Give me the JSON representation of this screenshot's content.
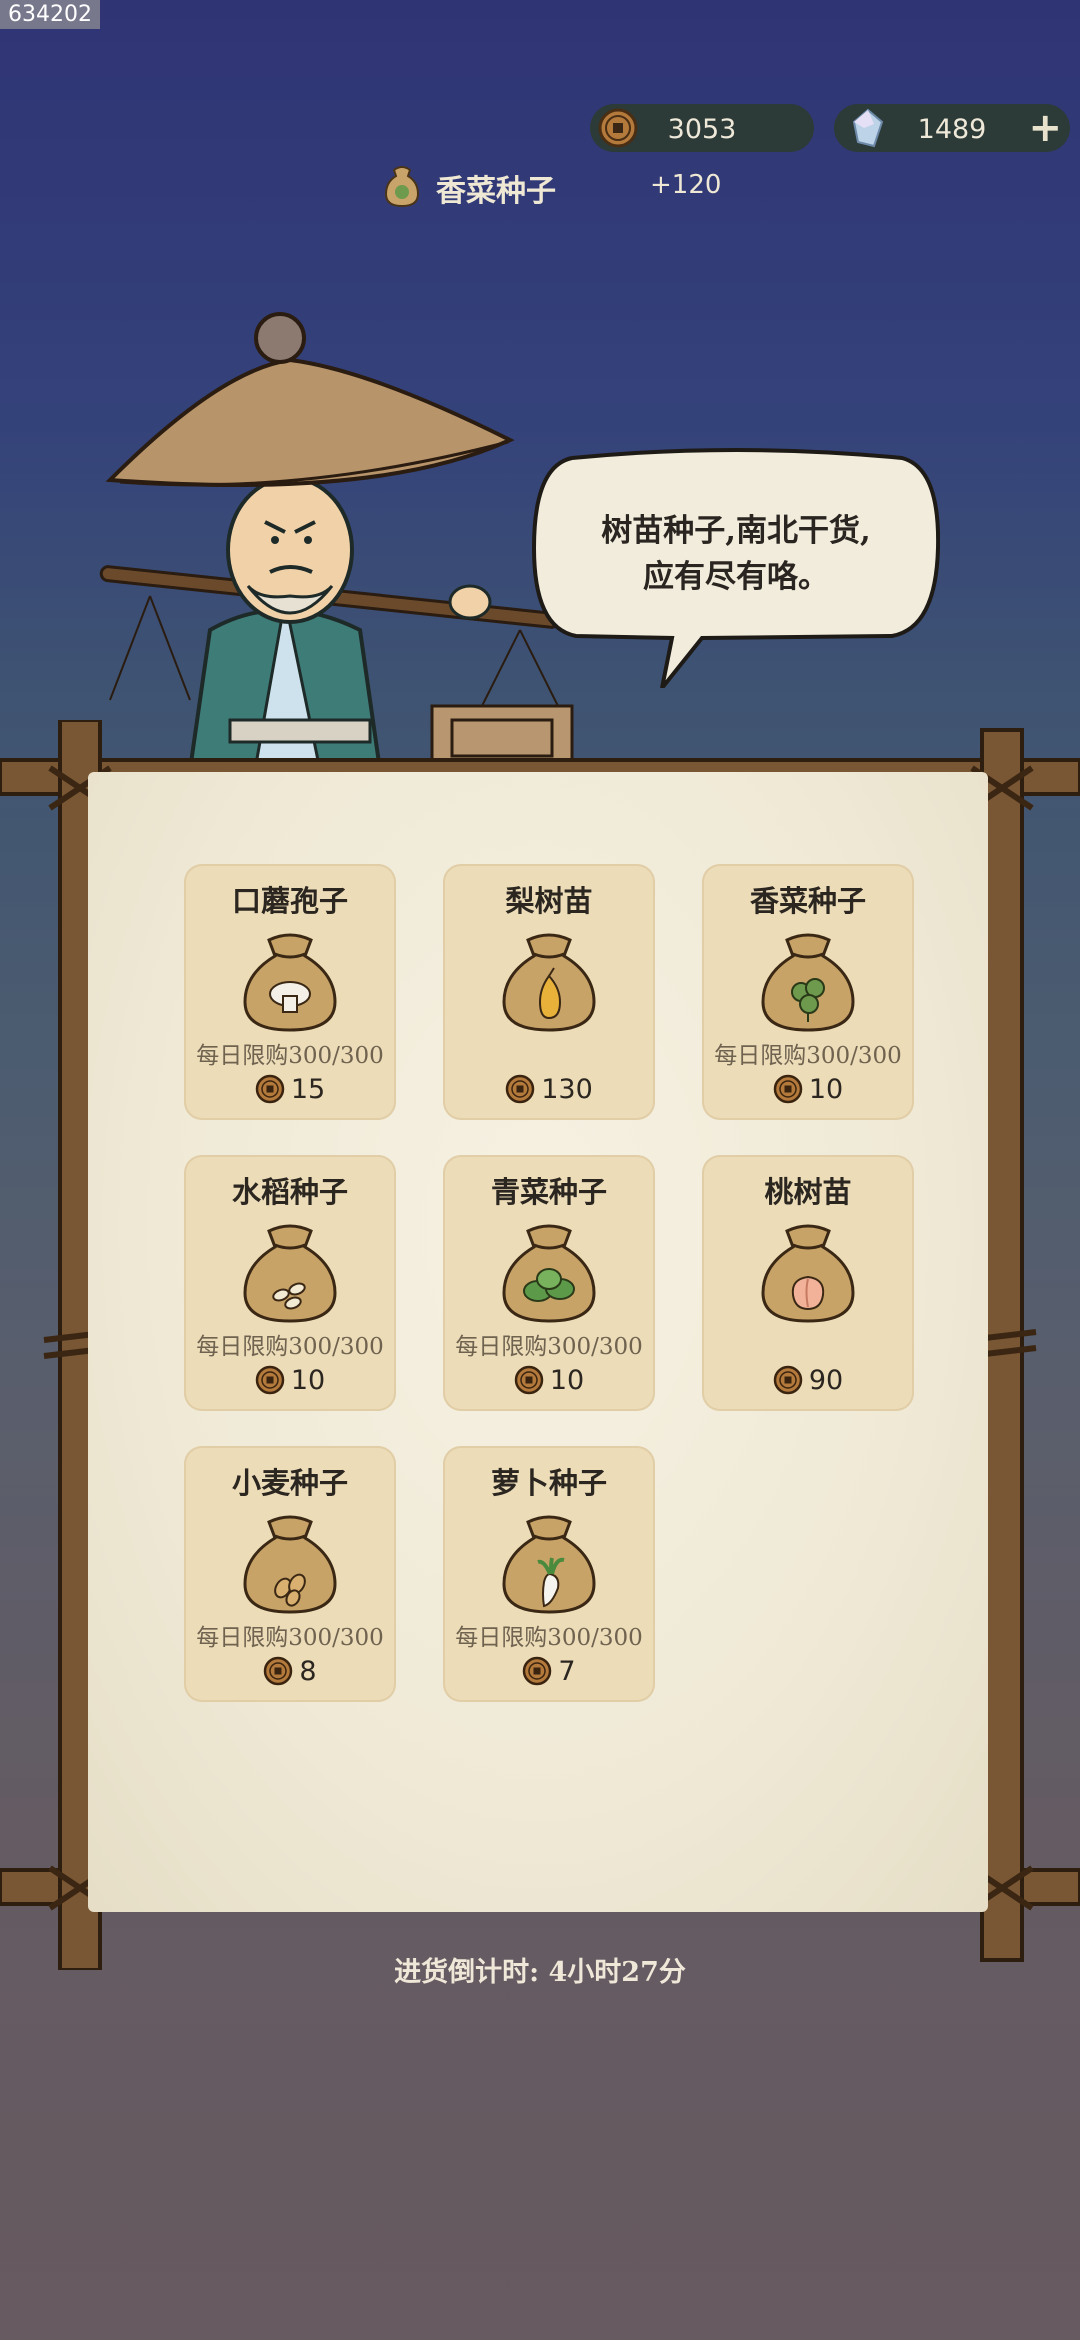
{
  "watermark": "634202",
  "currency": {
    "coins": "3053",
    "gems": "1489",
    "plus_label": "+"
  },
  "reward": {
    "name": "香菜种子",
    "amount": "+120"
  },
  "merchant": {
    "speech_line1": "树苗种子,南北干货,",
    "speech_line2": "应有尽有咯。"
  },
  "shop": {
    "items": [
      {
        "name": "口蘑孢子",
        "limit": "每日限购300/300",
        "price": "15",
        "icon": "mushroom"
      },
      {
        "name": "梨树苗",
        "limit": "",
        "price": "130",
        "icon": "pear"
      },
      {
        "name": "香菜种子",
        "limit": "每日限购300/300",
        "price": "10",
        "icon": "coriander"
      },
      {
        "name": "水稻种子",
        "limit": "每日限购300/300",
        "price": "10",
        "icon": "rice"
      },
      {
        "name": "青菜种子",
        "limit": "每日限购300/300",
        "price": "10",
        "icon": "greens"
      },
      {
        "name": "桃树苗",
        "limit": "",
        "price": "90",
        "icon": "peach"
      },
      {
        "name": "小麦种子",
        "limit": "每日限购300/300",
        "price": "8",
        "icon": "wheat"
      },
      {
        "name": "萝卜种子",
        "limit": "每日限购300/300",
        "price": "7",
        "icon": "radish"
      }
    ]
  },
  "countdown": "进货倒计时: 4小时27分",
  "colors": {
    "card_bg": "#ecdcb8",
    "paper": "#f3eddc",
    "wood": "#6b4a2c",
    "coin": "#8a5a2a"
  }
}
